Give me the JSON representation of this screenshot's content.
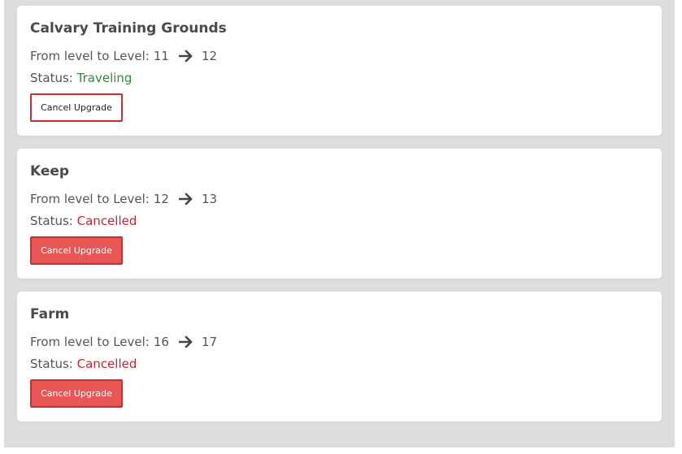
{
  "upgrades": [
    {
      "name": "Calvary Training Grounds",
      "level_prefix": "From level to Level:",
      "from_level": "11",
      "to_level": "12",
      "status_label": "Status:",
      "status": "Traveling",
      "button_label": "Cancel Upgrade"
    },
    {
      "name": "Keep",
      "level_prefix": "From level to Level:",
      "from_level": "12",
      "to_level": "13",
      "status_label": "Status:",
      "status": "Cancelled",
      "button_label": "Cancel Upgrade"
    },
    {
      "name": "Farm",
      "level_prefix": "From level to Level:",
      "from_level": "16",
      "to_level": "17",
      "status_label": "Status:",
      "status": "Cancelled",
      "button_label": "Cancel Upgrade"
    }
  ],
  "icons": {
    "arrow": "arrow-right-icon"
  },
  "colors": {
    "panel_bg": "#dddddd",
    "card_bg": "#ffffff",
    "title": "#4a4a4a",
    "text": "#555555",
    "status_traveling": "#2e8b3a",
    "status_cancelled": "#c82333",
    "button_border": "#c9302c",
    "button_filled_bg": "#e85656"
  }
}
